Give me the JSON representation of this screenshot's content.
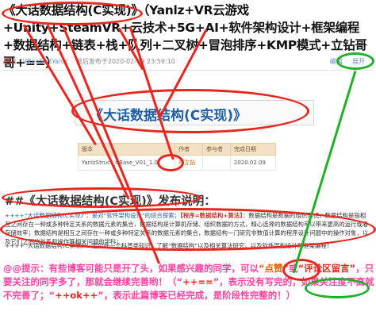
{
  "article": {
    "title": "《大话数据结构(C实现)》（Yanlz+VR云游戏+Unity+SteamVR+云技术+5G+AI+软件架构设计+框架编程+数据结构+链表+栈+队列+二叉树+冒泡排序+KMP模式+立钻哥哥+==）",
    "badge": "原创",
    "author": "VRunSoftYanlz",
    "published": "最后发布于2020-02-09 23:59:10",
    "edit_link": "编辑",
    "extra_link": "展开"
  },
  "book": {
    "title": "《大话数据结构(C实现)》"
  },
  "table": {
    "headers": [
      "版本",
      "作者",
      "参与者",
      "完成日期"
    ],
    "rows": [
      [
        "YanlzStruct_CBase_V01_1.0",
        "严立钻",
        "",
        "2020.02.09"
      ]
    ]
  },
  "section": {
    "heading": "##《大话数据结构(C实现)》发布说明：",
    "para1_prefix": "++++“大话数据结构(C实现)”：是对“软件架构设计”的综合探索；",
    "para1_highlight": "【程序=数据结构+算法】",
    "para1_rest": "：数据结构是数据的组织形式，数据结构是指相互之间存在一种或多种特定关系的数据元素的集合，数据结构是计算机存储、组织数据的方式，精心选择的数据结构可以带来更高的运行或者存储效率；数据结构是相互之间存在一种或多种特定关系的数据元素的集合，数据结构一门研究非数值计算的程序设计问题中的操作对象，以及它们之间的关系和操作等相关问题的学科；",
    "para2": "++++“大话数据结构(C实现)”：定位在一个科普类知识，了解“数据结构”以及相关算法研究，以及软件架构设计和框架编程！"
  },
  "tip": {
    "p1": "@@提示：有些博客可能只是开了头，如果感兴趣的同学，可以",
    "like": "“点赞”",
    "p2": "或",
    "comment": "“评论区留言”",
    "p3": "，只要关注的同学多了，那就会继续完善哟！（“",
    "plus": "++==",
    "p4": "”，表示没有写完的，如果关注度不高就不完善了；“",
    "ok": "++ok++",
    "p5": "”，表示此篇博客已经完成，是阶段性完整的！）"
  },
  "colors": {
    "annotation_red": "#e8261e",
    "annotation_green": "#22b02a",
    "tip_pink": "#ff3fa0",
    "link_blue": "#1f5fa8"
  }
}
